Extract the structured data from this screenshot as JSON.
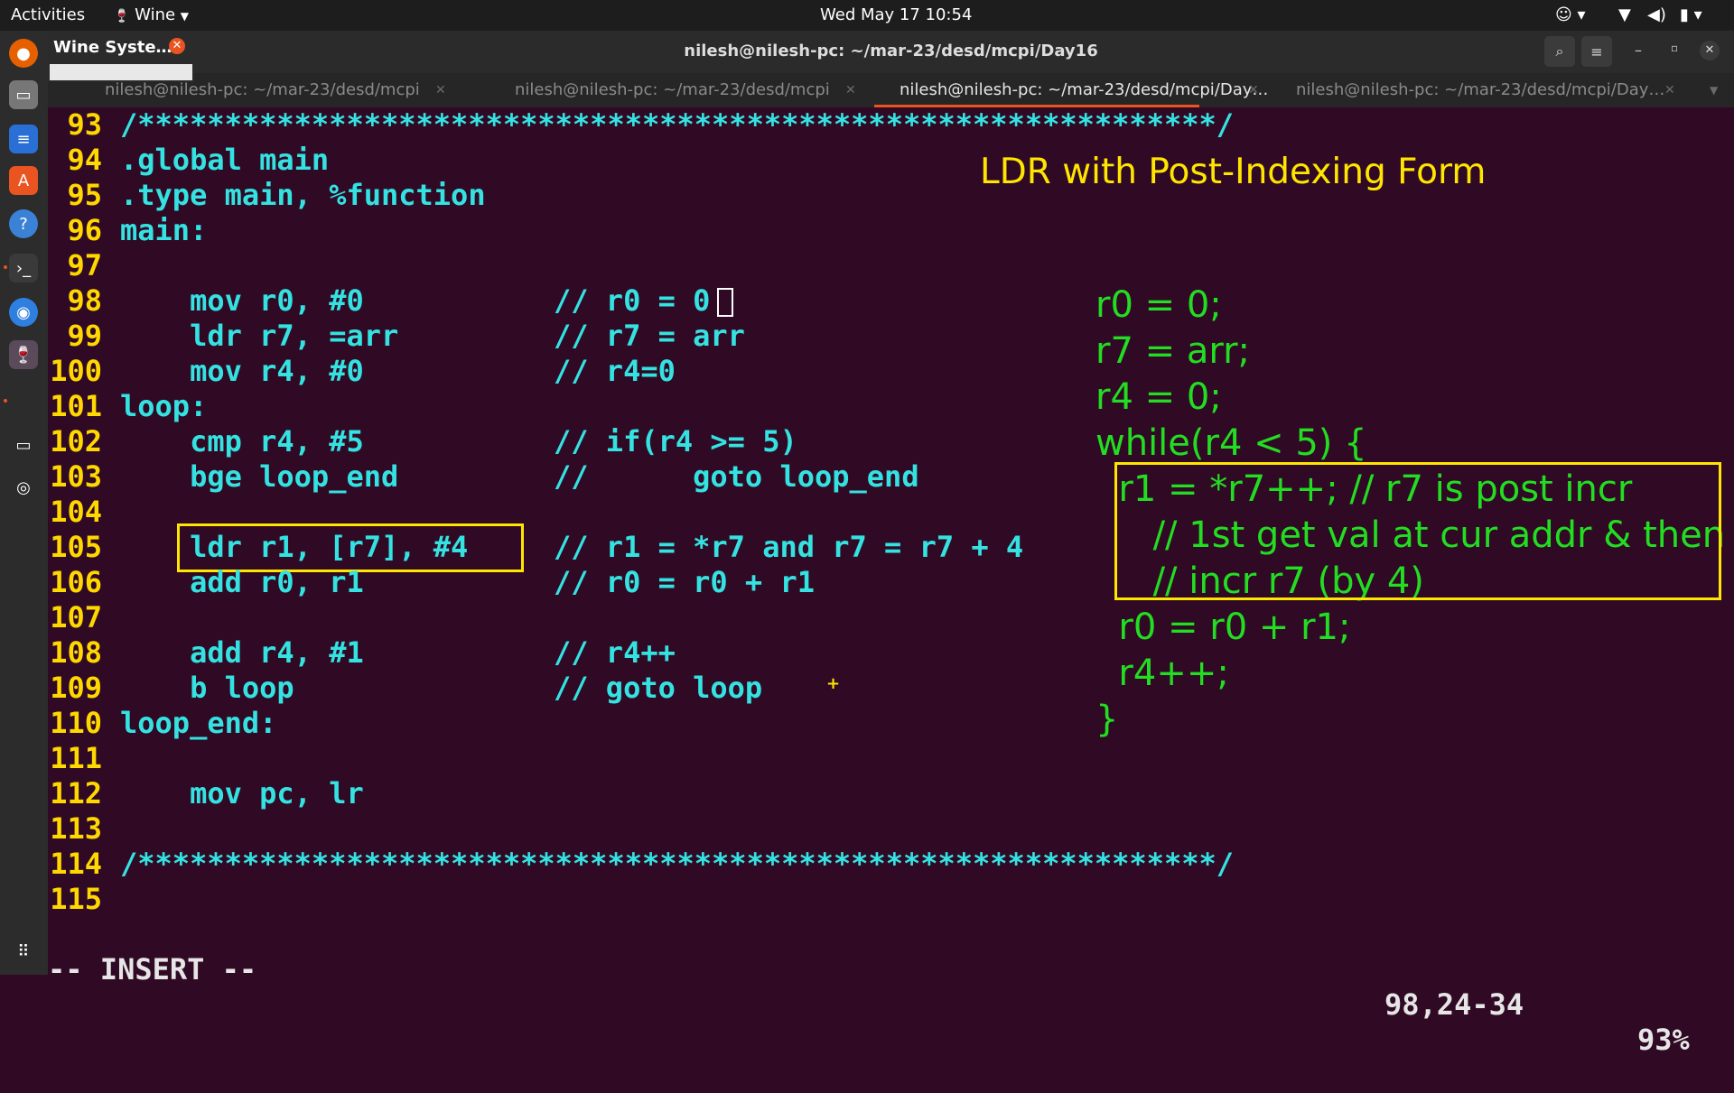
{
  "topbar": {
    "activities": "Activities",
    "app_menu": "Wine",
    "clock": "Wed May 17  10:54"
  },
  "notification": {
    "title": "Wine Syste…"
  },
  "window": {
    "title": "nilesh@nilesh-pc: ~/mar-23/desd/mcpi/Day16"
  },
  "tabs": [
    {
      "label": "nilesh@nilesh-pc: ~/mar-23/desd/mcpi",
      "active": false
    },
    {
      "label": "nilesh@nilesh-pc: ~/mar-23/desd/mcpi",
      "active": false
    },
    {
      "label": "nilesh@nilesh-pc: ~/mar-23/desd/mcpi/Day…",
      "active": true
    },
    {
      "label": "nilesh@nilesh-pc: ~/mar-23/desd/mcpi/Day…",
      "active": false
    }
  ],
  "editor": {
    "lines": [
      {
        "num": "93",
        "code": "/**************************************************************/",
        "comment": ""
      },
      {
        "num": "94",
        "code": ".global main",
        "comment": ""
      },
      {
        "num": "95",
        "code": ".type main, %function",
        "comment": ""
      },
      {
        "num": "96",
        "code": "main:",
        "comment": ""
      },
      {
        "num": "97",
        "code": "",
        "comment": ""
      },
      {
        "num": "98",
        "code": "    mov r0, #0",
        "comment": "// r0 = 0"
      },
      {
        "num": "99",
        "code": "    ldr r7, =arr",
        "comment": "// r7 = arr"
      },
      {
        "num": "100",
        "code": "    mov r4, #0",
        "comment": "// r4=0"
      },
      {
        "num": "101",
        "code": "loop:",
        "comment": ""
      },
      {
        "num": "102",
        "code": "    cmp r4, #5",
        "comment": "// if(r4 >= 5)"
      },
      {
        "num": "103",
        "code": "    bge loop_end",
        "comment": "//      goto loop_end"
      },
      {
        "num": "104",
        "code": "",
        "comment": ""
      },
      {
        "num": "105",
        "code": "    ldr r1, [r7], #4",
        "comment": "// r1 = *r7 and r7 = r7 + 4"
      },
      {
        "num": "106",
        "code": "    add r0, r1",
        "comment": "// r0 = r0 + r1"
      },
      {
        "num": "107",
        "code": "",
        "comment": ""
      },
      {
        "num": "108",
        "code": "    add r4, #1",
        "comment": "// r4++"
      },
      {
        "num": "109",
        "code": "    b loop",
        "comment": "// goto loop"
      },
      {
        "num": "110",
        "code": "loop_end:",
        "comment": ""
      },
      {
        "num": "111",
        "code": "",
        "comment": ""
      },
      {
        "num": "112",
        "code": "    mov pc, lr",
        "comment": ""
      },
      {
        "num": "113",
        "code": "",
        "comment": ""
      },
      {
        "num": "114",
        "code": "/**************************************************************/",
        "comment": ""
      },
      {
        "num": "115",
        "code": "",
        "comment": ""
      }
    ],
    "mode": "-- INSERT --",
    "cursor_pos": "98,24-34",
    "scroll_pct": "93%"
  },
  "annotation": {
    "heading": "LDR with Post-Indexing Form",
    "c_lines": [
      "r0 = 0;",
      "r7 = arr;",
      "r4 = 0;",
      "while(r4 < 5) {",
      "  r1 = *r7++; // r7 is post incr",
      "     // 1st get val at cur addr & then",
      "     // incr r7 (by 4)",
      "  r0 = r0 + r1;",
      "  r4++;",
      "}"
    ]
  },
  "colors": {
    "terminal_bg": "#300a24",
    "line_number": "#ffd800",
    "code_text": "#34e2e2",
    "annotation_heading": "#ffe600",
    "annotation_code": "#22dd22",
    "highlight_box": "#ffe600"
  }
}
